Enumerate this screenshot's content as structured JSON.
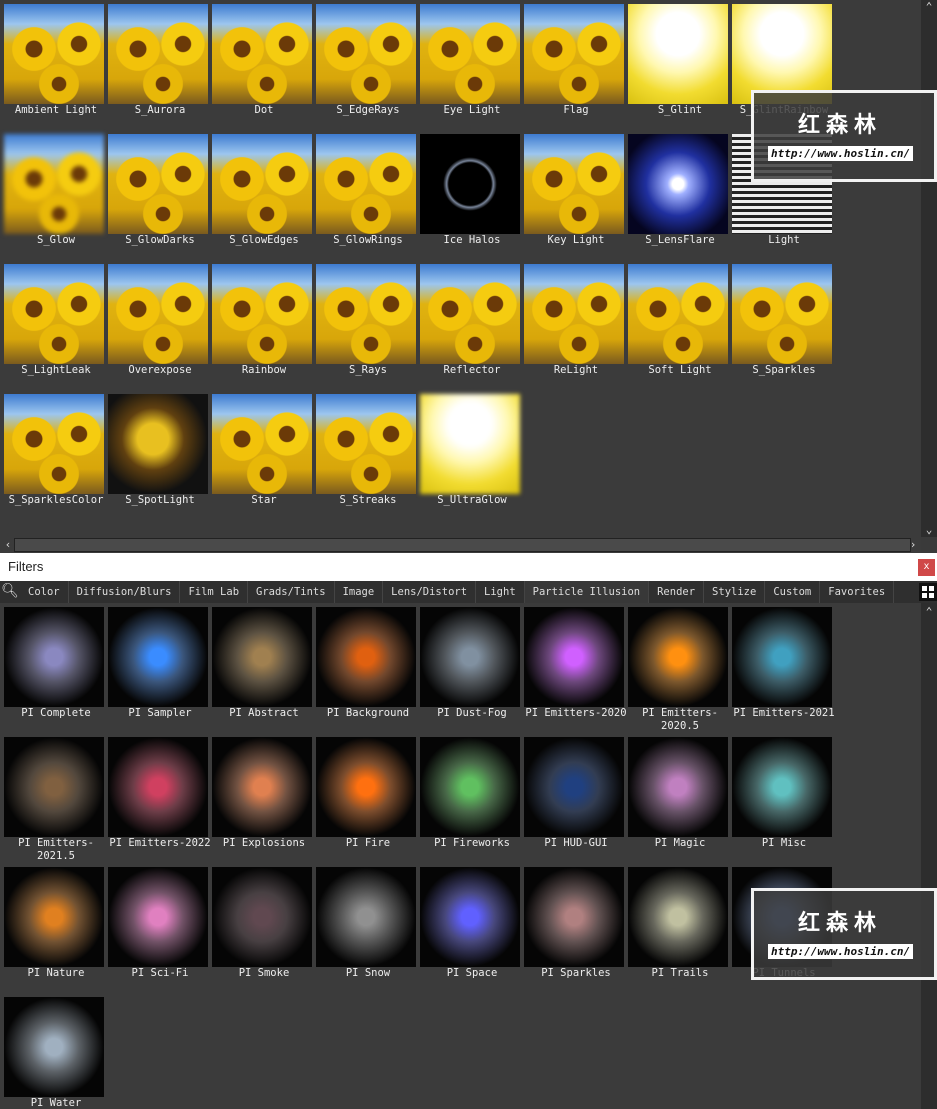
{
  "top_grid": [
    {
      "label": "Ambient Light",
      "thumb": "sunflower"
    },
    {
      "label": "S_Aurora",
      "thumb": "sunflower"
    },
    {
      "label": "Dot",
      "thumb": "sunflower"
    },
    {
      "label": "S_EdgeRays",
      "thumb": "sunflower"
    },
    {
      "label": "Eye Light",
      "thumb": "sunflower"
    },
    {
      "label": "Flag",
      "thumb": "sunflower"
    },
    {
      "label": "S_Glint",
      "thumb": "bright"
    },
    {
      "label": "S_GlintRainbow",
      "thumb": "bright"
    },
    {
      "label": "S_Glow",
      "thumb": "sunflower blur"
    },
    {
      "label": "S_GlowDarks",
      "thumb": "sunflower"
    },
    {
      "label": "S_GlowEdges",
      "thumb": "sunflower"
    },
    {
      "label": "S_GlowRings",
      "thumb": "sunflower"
    },
    {
      "label": "Ice Halos",
      "thumb": "halo"
    },
    {
      "label": "Key Light",
      "thumb": "sunflower"
    },
    {
      "label": "S_LensFlare",
      "thumb": "flare"
    },
    {
      "label": "Light",
      "thumb": "lines"
    },
    {
      "label": "S_LightLeak",
      "thumb": "sunflower"
    },
    {
      "label": "Overexpose",
      "thumb": "sunflower"
    },
    {
      "label": "Rainbow",
      "thumb": "sunflower"
    },
    {
      "label": "S_Rays",
      "thumb": "sunflower"
    },
    {
      "label": "Reflector",
      "thumb": "sunflower"
    },
    {
      "label": "ReLight",
      "thumb": "sunflower"
    },
    {
      "label": "Soft Light",
      "thumb": "sunflower"
    },
    {
      "label": "S_Sparkles",
      "thumb": "sunflower"
    },
    {
      "label": "S_SparklesColor",
      "thumb": "sunflower"
    },
    {
      "label": "S_SpotLight",
      "thumb": "spot"
    },
    {
      "label": "Star",
      "thumb": "sunflower"
    },
    {
      "label": "S_Streaks",
      "thumb": "sunflower"
    },
    {
      "label": "S_UltraGlow",
      "thumb": "bright blur"
    }
  ],
  "header": {
    "title": "Filters",
    "close": "x"
  },
  "tabs": [
    "Color",
    "Diffusion/Blurs",
    "Film Lab",
    "Grads/Tints",
    "Image",
    "Lens/Distort",
    "Light",
    "Particle Illusion",
    "Render",
    "Stylize",
    "Custom",
    "Favorites"
  ],
  "active_tab": "Particle Illusion",
  "bottom_grid": [
    {
      "label": "PI Complete",
      "color": "#8a88c0"
    },
    {
      "label": "PI Sampler",
      "color": "#3a8cff"
    },
    {
      "label": "PI Abstract",
      "color": "#a08050"
    },
    {
      "label": "PI Background",
      "color": "#e06010"
    },
    {
      "label": "PI Dust-Fog",
      "color": "#8090a0"
    },
    {
      "label": "PI Emitters-2020",
      "color": "#d060ff"
    },
    {
      "label": "PI Emitters-2020.5",
      "color": "#ff9010"
    },
    {
      "label": "PI Emitters-2021",
      "color": "#40a0c0"
    },
    {
      "label": "PI Emitters-2021.5",
      "color": "#806040"
    },
    {
      "label": "PI Emitters-2022",
      "color": "#d04060"
    },
    {
      "label": "PI Explosions",
      "color": "#e08050"
    },
    {
      "label": "PI Fire",
      "color": "#ff7010"
    },
    {
      "label": "PI Fireworks",
      "color": "#60c060"
    },
    {
      "label": "PI HUD-GUI",
      "color": "#204080"
    },
    {
      "label": "PI Magic",
      "color": "#c080c0"
    },
    {
      "label": "PI Misc",
      "color": "#60c0c0"
    },
    {
      "label": "PI Nature",
      "color": "#e08020"
    },
    {
      "label": "PI Sci-Fi",
      "color": "#e080c0"
    },
    {
      "label": "PI Smoke",
      "color": "#604850"
    },
    {
      "label": "PI Snow",
      "color": "#909090"
    },
    {
      "label": "PI Space",
      "color": "#6060ff"
    },
    {
      "label": "PI Sparkles",
      "color": "#b08080"
    },
    {
      "label": "PI Trails",
      "color": "#c0c0a0"
    },
    {
      "label": "PI Tunnels",
      "color": "#6080c0"
    },
    {
      "label": "PI Water",
      "color": "#a0b0c0"
    }
  ],
  "watermark": {
    "text": "红森林",
    "url": "http://www.hoslin.cn/"
  }
}
